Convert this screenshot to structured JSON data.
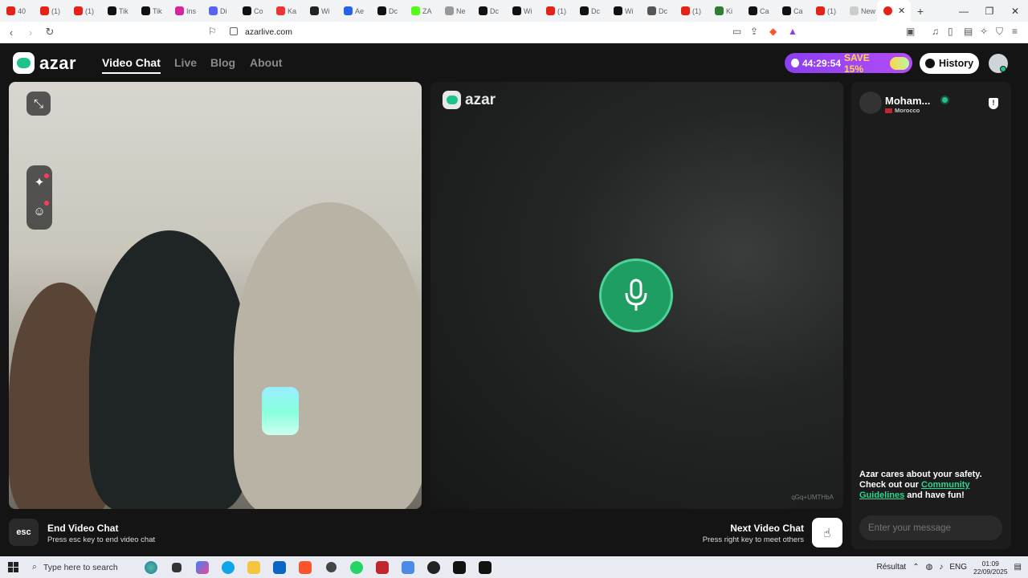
{
  "browser": {
    "tabs": [
      {
        "title": "40",
        "color": "#e62117"
      },
      {
        "title": "(1)",
        "color": "#e62117"
      },
      {
        "title": "(1)",
        "color": "#e62117"
      },
      {
        "title": "Tik",
        "color": "#111111"
      },
      {
        "title": "Tik",
        "color": "#111111"
      },
      {
        "title": "Ins",
        "color": "#d6249f"
      },
      {
        "title": "Di",
        "color": "#5865f2"
      },
      {
        "title": "Co",
        "color": "#111111"
      },
      {
        "title": "Ka",
        "color": "#e33"
      },
      {
        "title": "Wi",
        "color": "#222"
      },
      {
        "title": "Ae",
        "color": "#2563eb"
      },
      {
        "title": "Dc",
        "color": "#111"
      },
      {
        "title": "ZA",
        "color": "#53fc18"
      },
      {
        "title": "Ne",
        "color": "#999"
      },
      {
        "title": "Dc",
        "color": "#111"
      },
      {
        "title": "Wi",
        "color": "#111"
      },
      {
        "title": "(1)",
        "color": "#e62117"
      },
      {
        "title": "Dc",
        "color": "#111"
      },
      {
        "title": "Wi",
        "color": "#111"
      },
      {
        "title": "Dc",
        "color": "#555"
      },
      {
        "title": "(1)",
        "color": "#e62117"
      },
      {
        "title": "Ki",
        "color": "#2e7d32"
      },
      {
        "title": "Ca",
        "color": "#111"
      },
      {
        "title": "Ca",
        "color": "#111"
      },
      {
        "title": "(1)",
        "color": "#e62117"
      },
      {
        "title": "New t",
        "color": "#ccc"
      }
    ],
    "url": "azarlive.com"
  },
  "header": {
    "logo_text": "azar",
    "nav": [
      "Video Chat",
      "Live",
      "Blog",
      "About"
    ],
    "promo_timer": "44:29:54",
    "promo_save": "SAVE 15%",
    "history_label": "History"
  },
  "peer_logo_text": "azar",
  "peer_id": "qGq+UMTHbA",
  "side": {
    "peer_name": "Moham...",
    "peer_country": "Morocco",
    "safety_text_1": "Azar cares about your safety. Check out our ",
    "safety_link": "Community Guidelines",
    "safety_text_2": " and have fun!",
    "message_placeholder": "Enter your message"
  },
  "bottom": {
    "esc_key": "esc",
    "end_title": "End Video Chat",
    "end_sub": "Press esc key to end video chat",
    "next_title": "Next Video Chat",
    "next_sub": "Press right key to meet others"
  },
  "taskbar": {
    "search_placeholder": "Type here to search",
    "weather": "Résultat",
    "lang": "ENG",
    "time": "01:09",
    "date": "22/09/2025"
  },
  "colors": {
    "accent_green": "#1ec28b",
    "promo_purple": "#8a3ff0"
  }
}
